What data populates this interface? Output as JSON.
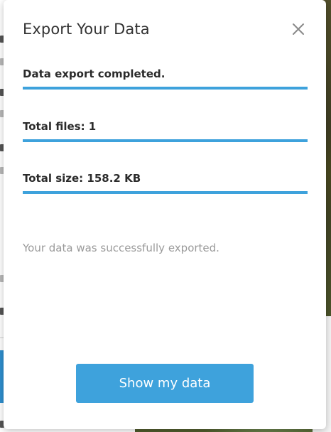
{
  "dialog": {
    "title": "Export Your Data",
    "close_icon": "close-icon",
    "status_text": "Data export completed.",
    "total_files": "Total files: 1",
    "total_size": "Total size: 158.2 KB",
    "message": "Your data was successfully exported.",
    "primary_button_label": "Show my data"
  },
  "colors": {
    "accent": "#3ea2dc",
    "title": "#333333",
    "muted_text": "#9a9a9a"
  }
}
